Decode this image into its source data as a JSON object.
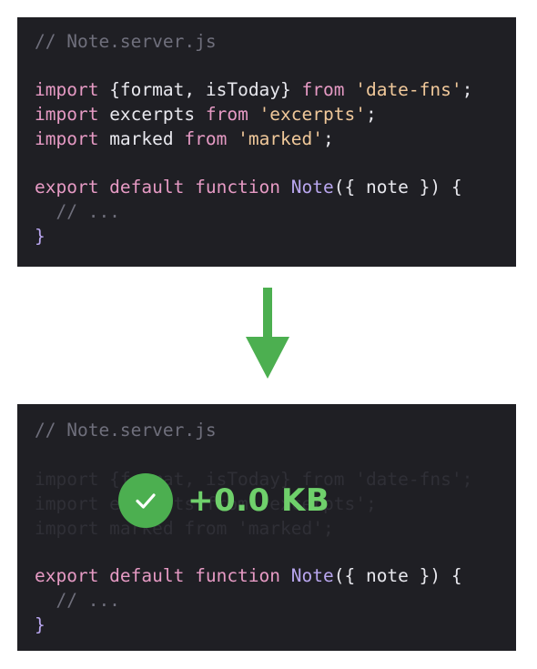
{
  "top_code": {
    "comment": "// Note.server.js",
    "line1": {
      "kw": "import",
      "body": " {format, isToday} ",
      "kw2": "from",
      "str": " 'date-fns'",
      "end": ";"
    },
    "line2": {
      "kw": "import",
      "body": " excerpts ",
      "kw2": "from",
      "str": " 'excerpts'",
      "end": ";"
    },
    "line3": {
      "kw": "import",
      "body": " marked ",
      "kw2": "from",
      "str": " 'marked'",
      "end": ";"
    },
    "line4": {
      "kw": "export default function",
      "fn": " Note",
      "body": "({ note }) {"
    },
    "line5": "  // ...",
    "line6": "}"
  },
  "bottom_code": {
    "comment": "// Note.server.js",
    "line1": "import {format, isToday} from 'date-fns';",
    "line2": "import excerpts from 'excerpts';",
    "line3": "import marked from 'marked';",
    "line4": {
      "kw": "export default function",
      "fn": " Note",
      "body": "({ note }) {"
    },
    "line5": "  // ...",
    "line6": "}"
  },
  "badge": {
    "text": "+0.0 KB",
    "icon": "check-icon"
  },
  "arrow": {
    "icon": "down-arrow-icon",
    "color": "#4caf50"
  },
  "colors": {
    "panel_bg": "#1f1f24",
    "keyword": "#e69ac4",
    "string": "#f0c89a",
    "function": "#b9a6ef",
    "comment": "#6f6f7c",
    "badge_green": "#6fd06b"
  }
}
